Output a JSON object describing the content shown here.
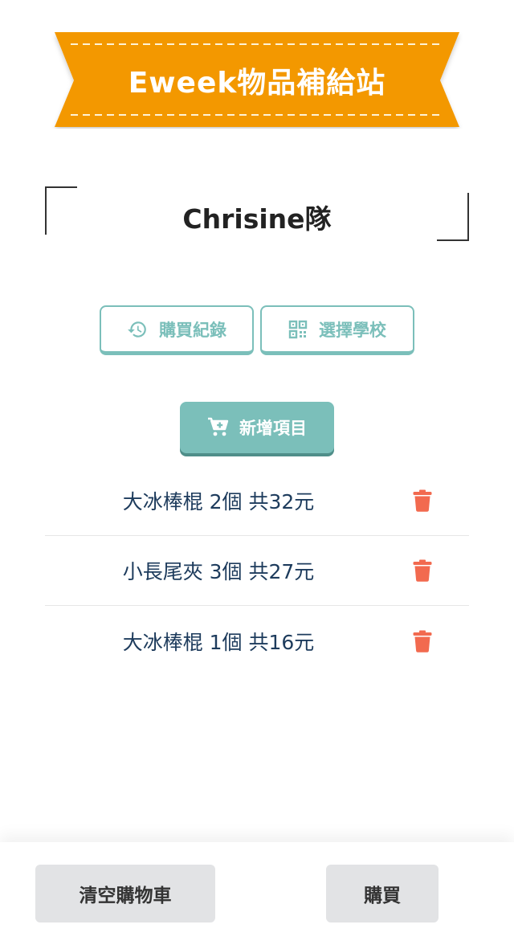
{
  "banner": {
    "title": "Eweek物品補給站",
    "color": "#f39800"
  },
  "team": {
    "name": "Chrisine隊"
  },
  "actions": {
    "history_label": "購買紀錄",
    "history_icon": "history-icon",
    "school_label": "選擇學校",
    "school_icon": "qr-code-icon",
    "add_label": "新增項目",
    "add_icon": "cart-plus-icon"
  },
  "cart": {
    "items": [
      {
        "text": "大冰棒棍 2個 共32元"
      },
      {
        "text": "小長尾夾 3個 共27元"
      },
      {
        "text": "大冰棒棍 1個 共16元"
      }
    ],
    "delete_icon": "trash-icon",
    "delete_color": "#f26a4f"
  },
  "footer": {
    "clear_label": "清空購物車",
    "buy_label": "購買"
  },
  "colors": {
    "accent": "#7bbfba",
    "text_dark": "#1d3b5c"
  }
}
